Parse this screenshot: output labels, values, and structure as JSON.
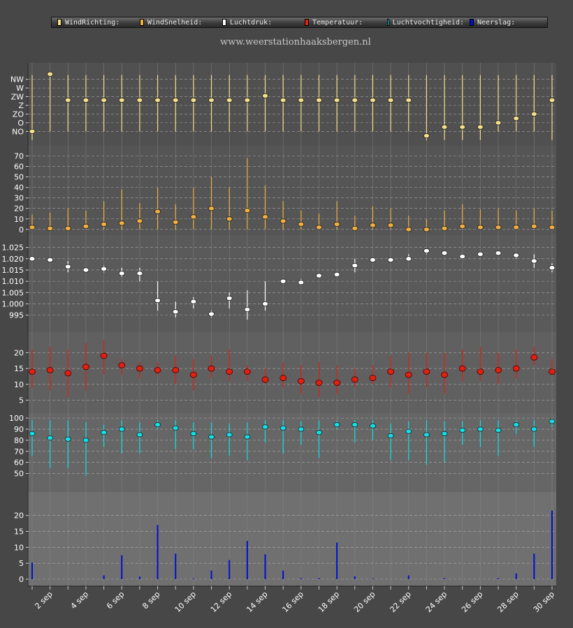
{
  "site": {
    "url_text": "www.weerstationhaaksbergen.nl"
  },
  "legend": [
    {
      "label": "WindRichting:",
      "color": "#f5e08a"
    },
    {
      "label": "WindSnelheid:",
      "color": "#f0b040"
    },
    {
      "label": "Luchtdruk:",
      "color": "#ffffff"
    },
    {
      "label": "Temperatuur:",
      "color": "#e02010"
    },
    {
      "label": "Luchtvochtigheid:",
      "color": "#10e0e8"
    },
    {
      "label": "Neerslag:",
      "color": "#0010d0"
    }
  ],
  "chart_data": [
    {
      "type": "scatter",
      "panel": "WindRichting",
      "color": "#f5e08a",
      "y_ticks": [
        "NO",
        "O",
        "ZO",
        "Z",
        "ZW",
        "W",
        "NW"
      ],
      "ylim": [
        0,
        6.5
      ],
      "x": [
        1,
        2,
        3,
        4,
        5,
        6,
        7,
        8,
        9,
        10,
        11,
        12,
        13,
        14,
        15,
        16,
        17,
        18,
        19,
        20,
        21,
        22,
        23,
        24,
        25,
        26,
        27,
        28,
        29,
        30
      ],
      "values": [
        0,
        6.6,
        3.6,
        3.6,
        3.6,
        3.6,
        3.6,
        3.6,
        3.6,
        3.6,
        3.6,
        3.6,
        3.6,
        4.1,
        3.6,
        3.6,
        3.6,
        3.6,
        3.6,
        3.6,
        3.6,
        3.6,
        -0.5,
        0.5,
        0.5,
        0.5,
        1,
        1.5,
        2,
        3.6
      ],
      "low": [
        -1,
        0,
        0,
        0,
        0,
        0,
        0,
        0,
        0,
        0,
        0,
        0,
        0,
        0,
        0,
        0,
        0,
        0,
        0,
        0,
        0,
        0,
        -1,
        -1,
        -1,
        -1,
        0,
        0,
        0,
        -1
      ],
      "high": [
        6.5,
        6.5,
        6.5,
        6.5,
        6.5,
        6.5,
        6.5,
        6.5,
        6.5,
        6.5,
        6.5,
        6.5,
        6.5,
        6.5,
        6.5,
        6.5,
        6.5,
        6.5,
        6.5,
        6.5,
        6.5,
        6.5,
        6.5,
        6.5,
        6.5,
        6.5,
        6.5,
        6.5,
        6.5,
        6.5
      ]
    },
    {
      "type": "scatter",
      "panel": "WindSnelheid",
      "color": "#f0b040",
      "y_ticks": [
        "0",
        "10",
        "20",
        "30",
        "40",
        "50",
        "60",
        "70"
      ],
      "ylim": [
        0,
        72
      ],
      "x": [
        1,
        2,
        3,
        4,
        5,
        6,
        7,
        8,
        9,
        10,
        11,
        12,
        13,
        14,
        15,
        16,
        17,
        18,
        19,
        20,
        21,
        22,
        23,
        24,
        25,
        26,
        27,
        28,
        29,
        30
      ],
      "values": [
        2,
        1,
        1,
        3,
        5,
        6,
        8,
        17,
        7,
        12,
        20,
        10,
        18,
        12,
        8,
        5,
        2,
        5,
        1,
        4,
        4,
        0,
        0,
        1,
        3,
        2,
        2,
        2,
        3,
        2
      ],
      "low": [
        0,
        0,
        0,
        0,
        0,
        0,
        0,
        0,
        0,
        0,
        0,
        0,
        0,
        0,
        0,
        0,
        0,
        0,
        0,
        0,
        0,
        0,
        0,
        0,
        0,
        0,
        0,
        0,
        0,
        0
      ],
      "high": [
        14,
        16,
        20,
        18,
        27,
        38,
        25,
        40,
        24,
        40,
        50,
        40,
        68,
        42,
        27,
        18,
        15,
        27,
        13,
        22,
        20,
        13,
        10,
        18,
        24,
        19,
        20,
        18,
        20,
        18
      ]
    },
    {
      "type": "scatter",
      "panel": "Luchtdruk",
      "color": "#ffffff",
      "y_ticks": [
        "995",
        "1.000",
        "1.005",
        "1.010",
        "1.015",
        "1.020",
        "1.025"
      ],
      "ylim": [
        990,
        1027
      ],
      "x": [
        1,
        2,
        3,
        4,
        5,
        6,
        7,
        8,
        9,
        10,
        11,
        12,
        13,
        14,
        15,
        16,
        17,
        18,
        19,
        20,
        21,
        22,
        23,
        24,
        25,
        26,
        27,
        28,
        29,
        30
      ],
      "values": [
        1020,
        1019.5,
        1016.5,
        1015,
        1015.5,
        1013.5,
        1013.5,
        1001.5,
        996.5,
        1001,
        995.5,
        1002.5,
        997.5,
        1000,
        1010,
        1009.5,
        1012.5,
        1013,
        1017,
        1019.5,
        1019.5,
        1020,
        1023.5,
        1022.5,
        1021,
        1022,
        1022.5,
        1021.5,
        1019,
        1016
      ],
      "low": [
        1019,
        1019,
        1014,
        1014,
        1014,
        1012,
        1010,
        997,
        994,
        998,
        994,
        998,
        993,
        997,
        1009,
        1009,
        1012,
        1012,
        1014,
        1019,
        1019,
        1019,
        1022,
        1022,
        1020,
        1021,
        1022,
        1020,
        1016,
        1014
      ],
      "high": [
        1021,
        1020,
        1019,
        1016,
        1017,
        1016,
        1016,
        1010,
        1001,
        1003,
        997,
        1005,
        1006,
        1010,
        1011,
        1011,
        1013,
        1014,
        1020,
        1020,
        1020,
        1022,
        1024,
        1023,
        1022,
        1023,
        1023,
        1022,
        1022,
        1018
      ]
    },
    {
      "type": "scatter",
      "panel": "Temperatuur",
      "color": "#e02010",
      "y_ticks": [
        "5",
        "10",
        "15",
        "20"
      ],
      "ylim": [
        3,
        25
      ],
      "x": [
        1,
        2,
        3,
        4,
        5,
        6,
        7,
        8,
        9,
        10,
        11,
        12,
        13,
        14,
        15,
        16,
        17,
        18,
        19,
        20,
        21,
        22,
        23,
        24,
        25,
        26,
        27,
        28,
        29,
        30
      ],
      "values": [
        14,
        14.5,
        13.5,
        15.5,
        19,
        16,
        15,
        14.5,
        14.5,
        13,
        15,
        14,
        14,
        11.5,
        12,
        11,
        10.5,
        10.5,
        11.5,
        12,
        14,
        13,
        14,
        13,
        15,
        14,
        14.5,
        15,
        18.5,
        14
      ],
      "low": [
        9,
        8,
        6,
        8,
        13,
        13,
        12,
        13,
        10,
        8,
        12,
        11,
        11,
        10,
        9,
        7,
        6,
        7,
        9,
        10,
        9,
        7,
        9,
        7,
        11,
        11,
        10,
        12,
        16,
        13
      ],
      "high": [
        21,
        22,
        21,
        23,
        24,
        18,
        17,
        17,
        19,
        18,
        19,
        21,
        16,
        15,
        17,
        16,
        17,
        16,
        15,
        16,
        19,
        20,
        20,
        20,
        21,
        22,
        20,
        21,
        22,
        18
      ]
    },
    {
      "type": "scatter",
      "panel": "Luchtvochtigheid",
      "color": "#10e0e8",
      "y_ticks": [
        "50",
        "60",
        "70",
        "80",
        "90",
        "100"
      ],
      "ylim": [
        40,
        101
      ],
      "x": [
        1,
        2,
        3,
        4,
        5,
        6,
        7,
        8,
        9,
        10,
        11,
        12,
        13,
        14,
        15,
        16,
        17,
        18,
        19,
        20,
        21,
        22,
        23,
        24,
        25,
        26,
        27,
        28,
        29,
        30
      ],
      "values": [
        86,
        82,
        81,
        80,
        87,
        90,
        85,
        94,
        91,
        86,
        83,
        85,
        83,
        92,
        91,
        90,
        87,
        94,
        94,
        93,
        84,
        88,
        85,
        86,
        89,
        90,
        89,
        94,
        90,
        97
      ],
      "low": [
        66,
        55,
        55,
        48,
        74,
        68,
        68,
        90,
        72,
        72,
        64,
        66,
        62,
        78,
        68,
        76,
        64,
        90,
        78,
        80,
        62,
        62,
        58,
        60,
        76,
        74,
        66,
        86,
        74,
        92
      ],
      "high": [
        98,
        98,
        98,
        96,
        94,
        98,
        96,
        98,
        98,
        96,
        96,
        95,
        96,
        98,
        98,
        97,
        98,
        98,
        98,
        98,
        95,
        97,
        98,
        97,
        97,
        98,
        98,
        98,
        98,
        99
      ]
    },
    {
      "type": "bar",
      "panel": "Neerslag",
      "color": "#0010d0",
      "y_ticks": [
        "0",
        "5",
        "10",
        "15",
        "20"
      ],
      "ylim": [
        0,
        22
      ],
      "x": [
        1,
        2,
        3,
        4,
        5,
        6,
        7,
        8,
        9,
        10,
        11,
        12,
        13,
        14,
        15,
        16,
        17,
        18,
        19,
        20,
        21,
        22,
        23,
        24,
        25,
        26,
        27,
        28,
        29,
        30
      ],
      "values": [
        5.2,
        0,
        0,
        0,
        1.2,
        7.5,
        0.8,
        17,
        8,
        0.2,
        2.7,
        6,
        12,
        7.8,
        2.7,
        0.3,
        0.3,
        11.5,
        0.9,
        0.2,
        0,
        1.2,
        0,
        0.3,
        0,
        0,
        0.3,
        1.8,
        8,
        21.5
      ]
    },
    {
      "type": "x-axis",
      "tick_labels": [
        "2 sep",
        "4 sep",
        "6 sep",
        "8 sep",
        "10 sep",
        "12 sep",
        "14 sep",
        "16 sep",
        "18 sep",
        "20 sep",
        "22 sep",
        "24 sep",
        "26 sep",
        "28 sep",
        "30 sep"
      ],
      "tick_days": [
        2,
        4,
        6,
        8,
        10,
        12,
        14,
        16,
        18,
        20,
        22,
        24,
        26,
        28,
        30
      ]
    }
  ]
}
